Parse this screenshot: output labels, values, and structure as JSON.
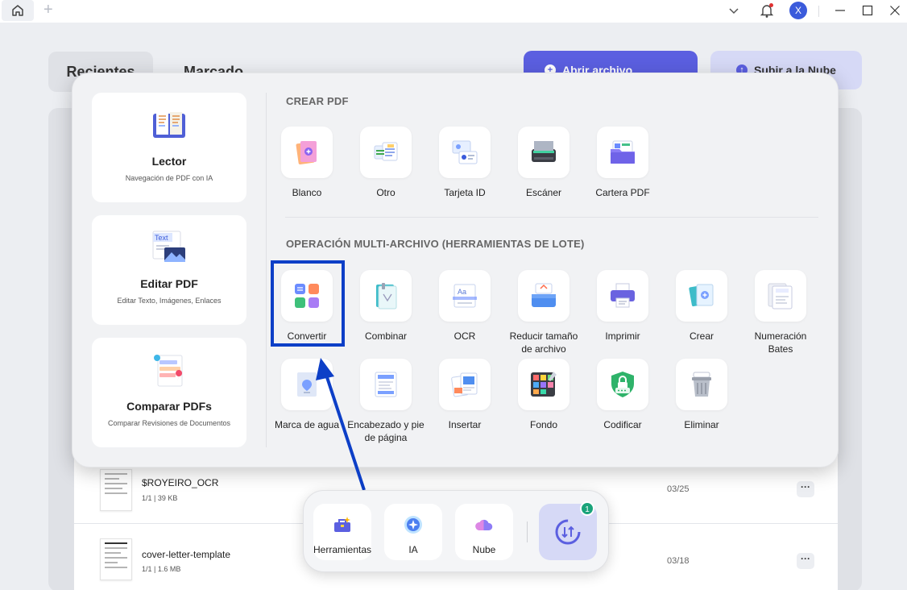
{
  "titlebar": {
    "avatar_letter": "X",
    "icons": [
      "home-icon",
      "plus-icon",
      "chevron-down-icon",
      "bell-icon",
      "minimize-icon",
      "maximize-icon",
      "close-icon"
    ]
  },
  "background": {
    "tabs": [
      {
        "label": "Recientes"
      },
      {
        "label": "Marcado"
      }
    ],
    "open_file_label": "Abrir archivo",
    "upload_label": "Subir a la Nube",
    "files": [
      {
        "name": "$ROYEIRO_OCR",
        "meta": "1/1 | 39 KB",
        "date": "03/25"
      },
      {
        "name": "cover-letter-template",
        "meta": "1/1 | 1.6 MB",
        "date": "03/18"
      }
    ]
  },
  "panel": {
    "cards": [
      {
        "title": "Lector",
        "desc": "Navegación de PDF con IA",
        "icon": "book-icon"
      },
      {
        "title": "Editar PDF",
        "desc": "Editar Texto, Imágenes, Enlaces",
        "icon": "edit-text-icon",
        "icon_text": "Text"
      },
      {
        "title": "Comparar PDFs",
        "desc": "Comparar Revisiones de Documentos",
        "icon": "compare-icon"
      }
    ],
    "create_title": "CREAR PDF",
    "create_tools": [
      {
        "label": "Blanco"
      },
      {
        "label": "Otro"
      },
      {
        "label": "Tarjeta ID"
      },
      {
        "label": "Escáner"
      },
      {
        "label": "Cartera PDF"
      }
    ],
    "batch_title": "OPERACIÓN MULTI-ARCHIVO (HERRAMIENTAS DE LOTE)",
    "batch_tools": [
      {
        "label": "Convertir"
      },
      {
        "label": "Combinar"
      },
      {
        "label": "OCR"
      },
      {
        "label": "Reducir tamaño de archivo"
      },
      {
        "label": "Imprimir"
      },
      {
        "label": "Crear"
      },
      {
        "label": "Numeración Bates"
      },
      {
        "label": "Marca de agua"
      },
      {
        "label": "Encabezado y pie de página"
      },
      {
        "label": "Insertar"
      },
      {
        "label": "Fondo"
      },
      {
        "label": "Codificar"
      },
      {
        "label": "Eliminar"
      }
    ]
  },
  "dock": {
    "items": [
      {
        "label": "Herramientas"
      },
      {
        "label": "IA"
      },
      {
        "label": "Nube"
      }
    ],
    "sync_badge": "1"
  },
  "colors": {
    "accent": "#0d3fc7",
    "primary": "#5b5fe0",
    "sync_bg": "#d6d9f6"
  }
}
